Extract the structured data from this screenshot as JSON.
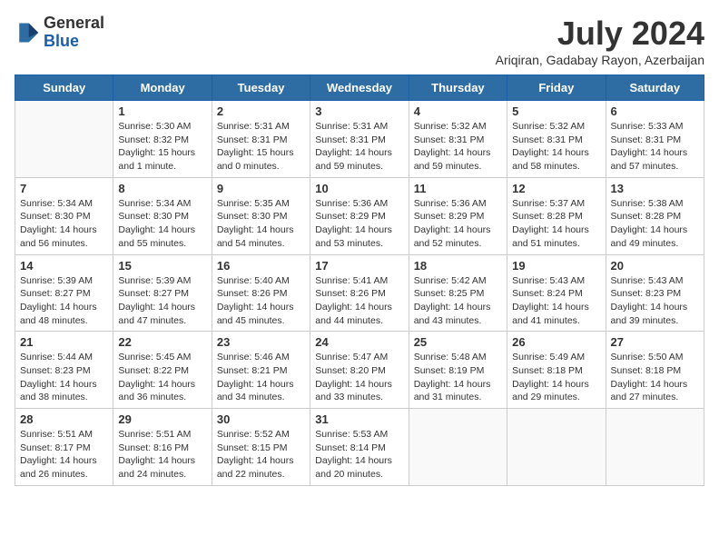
{
  "logo": {
    "general": "General",
    "blue": "Blue"
  },
  "header": {
    "month": "July 2024",
    "location": "Ariqiran, Gadabay Rayon, Azerbaijan"
  },
  "weekdays": [
    "Sunday",
    "Monday",
    "Tuesday",
    "Wednesday",
    "Thursday",
    "Friday",
    "Saturday"
  ],
  "weeks": [
    [
      {
        "day": "",
        "sunrise": "",
        "sunset": "",
        "daylight": ""
      },
      {
        "day": "1",
        "sunrise": "Sunrise: 5:30 AM",
        "sunset": "Sunset: 8:32 PM",
        "daylight": "Daylight: 15 hours and 1 minute."
      },
      {
        "day": "2",
        "sunrise": "Sunrise: 5:31 AM",
        "sunset": "Sunset: 8:31 PM",
        "daylight": "Daylight: 15 hours and 0 minutes."
      },
      {
        "day": "3",
        "sunrise": "Sunrise: 5:31 AM",
        "sunset": "Sunset: 8:31 PM",
        "daylight": "Daylight: 14 hours and 59 minutes."
      },
      {
        "day": "4",
        "sunrise": "Sunrise: 5:32 AM",
        "sunset": "Sunset: 8:31 PM",
        "daylight": "Daylight: 14 hours and 59 minutes."
      },
      {
        "day": "5",
        "sunrise": "Sunrise: 5:32 AM",
        "sunset": "Sunset: 8:31 PM",
        "daylight": "Daylight: 14 hours and 58 minutes."
      },
      {
        "day": "6",
        "sunrise": "Sunrise: 5:33 AM",
        "sunset": "Sunset: 8:31 PM",
        "daylight": "Daylight: 14 hours and 57 minutes."
      }
    ],
    [
      {
        "day": "7",
        "sunrise": "Sunrise: 5:34 AM",
        "sunset": "Sunset: 8:30 PM",
        "daylight": "Daylight: 14 hours and 56 minutes."
      },
      {
        "day": "8",
        "sunrise": "Sunrise: 5:34 AM",
        "sunset": "Sunset: 8:30 PM",
        "daylight": "Daylight: 14 hours and 55 minutes."
      },
      {
        "day": "9",
        "sunrise": "Sunrise: 5:35 AM",
        "sunset": "Sunset: 8:30 PM",
        "daylight": "Daylight: 14 hours and 54 minutes."
      },
      {
        "day": "10",
        "sunrise": "Sunrise: 5:36 AM",
        "sunset": "Sunset: 8:29 PM",
        "daylight": "Daylight: 14 hours and 53 minutes."
      },
      {
        "day": "11",
        "sunrise": "Sunrise: 5:36 AM",
        "sunset": "Sunset: 8:29 PM",
        "daylight": "Daylight: 14 hours and 52 minutes."
      },
      {
        "day": "12",
        "sunrise": "Sunrise: 5:37 AM",
        "sunset": "Sunset: 8:28 PM",
        "daylight": "Daylight: 14 hours and 51 minutes."
      },
      {
        "day": "13",
        "sunrise": "Sunrise: 5:38 AM",
        "sunset": "Sunset: 8:28 PM",
        "daylight": "Daylight: 14 hours and 49 minutes."
      }
    ],
    [
      {
        "day": "14",
        "sunrise": "Sunrise: 5:39 AM",
        "sunset": "Sunset: 8:27 PM",
        "daylight": "Daylight: 14 hours and 48 minutes."
      },
      {
        "day": "15",
        "sunrise": "Sunrise: 5:39 AM",
        "sunset": "Sunset: 8:27 PM",
        "daylight": "Daylight: 14 hours and 47 minutes."
      },
      {
        "day": "16",
        "sunrise": "Sunrise: 5:40 AM",
        "sunset": "Sunset: 8:26 PM",
        "daylight": "Daylight: 14 hours and 45 minutes."
      },
      {
        "day": "17",
        "sunrise": "Sunrise: 5:41 AM",
        "sunset": "Sunset: 8:26 PM",
        "daylight": "Daylight: 14 hours and 44 minutes."
      },
      {
        "day": "18",
        "sunrise": "Sunrise: 5:42 AM",
        "sunset": "Sunset: 8:25 PM",
        "daylight": "Daylight: 14 hours and 43 minutes."
      },
      {
        "day": "19",
        "sunrise": "Sunrise: 5:43 AM",
        "sunset": "Sunset: 8:24 PM",
        "daylight": "Daylight: 14 hours and 41 minutes."
      },
      {
        "day": "20",
        "sunrise": "Sunrise: 5:43 AM",
        "sunset": "Sunset: 8:23 PM",
        "daylight": "Daylight: 14 hours and 39 minutes."
      }
    ],
    [
      {
        "day": "21",
        "sunrise": "Sunrise: 5:44 AM",
        "sunset": "Sunset: 8:23 PM",
        "daylight": "Daylight: 14 hours and 38 minutes."
      },
      {
        "day": "22",
        "sunrise": "Sunrise: 5:45 AM",
        "sunset": "Sunset: 8:22 PM",
        "daylight": "Daylight: 14 hours and 36 minutes."
      },
      {
        "day": "23",
        "sunrise": "Sunrise: 5:46 AM",
        "sunset": "Sunset: 8:21 PM",
        "daylight": "Daylight: 14 hours and 34 minutes."
      },
      {
        "day": "24",
        "sunrise": "Sunrise: 5:47 AM",
        "sunset": "Sunset: 8:20 PM",
        "daylight": "Daylight: 14 hours and 33 minutes."
      },
      {
        "day": "25",
        "sunrise": "Sunrise: 5:48 AM",
        "sunset": "Sunset: 8:19 PM",
        "daylight": "Daylight: 14 hours and 31 minutes."
      },
      {
        "day": "26",
        "sunrise": "Sunrise: 5:49 AM",
        "sunset": "Sunset: 8:18 PM",
        "daylight": "Daylight: 14 hours and 29 minutes."
      },
      {
        "day": "27",
        "sunrise": "Sunrise: 5:50 AM",
        "sunset": "Sunset: 8:18 PM",
        "daylight": "Daylight: 14 hours and 27 minutes."
      }
    ],
    [
      {
        "day": "28",
        "sunrise": "Sunrise: 5:51 AM",
        "sunset": "Sunset: 8:17 PM",
        "daylight": "Daylight: 14 hours and 26 minutes."
      },
      {
        "day": "29",
        "sunrise": "Sunrise: 5:51 AM",
        "sunset": "Sunset: 8:16 PM",
        "daylight": "Daylight: 14 hours and 24 minutes."
      },
      {
        "day": "30",
        "sunrise": "Sunrise: 5:52 AM",
        "sunset": "Sunset: 8:15 PM",
        "daylight": "Daylight: 14 hours and 22 minutes."
      },
      {
        "day": "31",
        "sunrise": "Sunrise: 5:53 AM",
        "sunset": "Sunset: 8:14 PM",
        "daylight": "Daylight: 14 hours and 20 minutes."
      },
      {
        "day": "",
        "sunrise": "",
        "sunset": "",
        "daylight": ""
      },
      {
        "day": "",
        "sunrise": "",
        "sunset": "",
        "daylight": ""
      },
      {
        "day": "",
        "sunrise": "",
        "sunset": "",
        "daylight": ""
      }
    ]
  ]
}
